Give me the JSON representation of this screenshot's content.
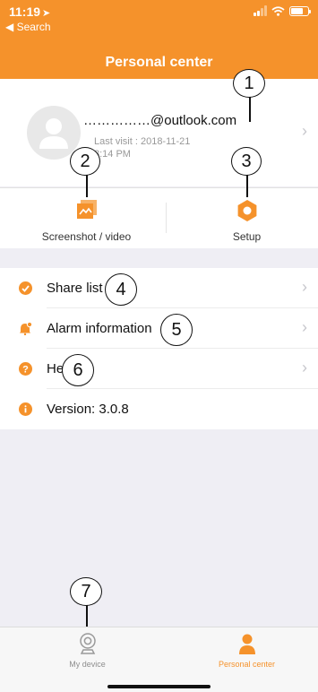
{
  "status": {
    "time": "11:19",
    "back_label": "◀ Search"
  },
  "header": {
    "title": "Personal center"
  },
  "profile": {
    "email": "……………@outlook.com",
    "last_visit": "Last visit : 2018-11-21",
    "last_visit_time": "3:14 PM"
  },
  "quick_actions": [
    {
      "label": "Screenshot / video",
      "icon": "screenshot-video-icon"
    },
    {
      "label": "Setup",
      "icon": "setup-gear-icon"
    }
  ],
  "menu": [
    {
      "label": "Share list",
      "icon": "share-icon"
    },
    {
      "label": "Alarm information",
      "icon": "alarm-icon"
    },
    {
      "label": "Help",
      "icon": "help-icon"
    },
    {
      "label": "Version: 3.0.8",
      "icon": "info-icon"
    }
  ],
  "callouts": [
    "1",
    "2",
    "3",
    "4",
    "5",
    "6",
    "7"
  ],
  "tabs": [
    {
      "label": "My device",
      "icon": "camera-icon",
      "color": "#8e8e8e"
    },
    {
      "label": "Personal center",
      "icon": "person-icon",
      "color": "#f5922b"
    }
  ],
  "colors": {
    "accent": "#f5922b",
    "background": "#efeef4"
  }
}
